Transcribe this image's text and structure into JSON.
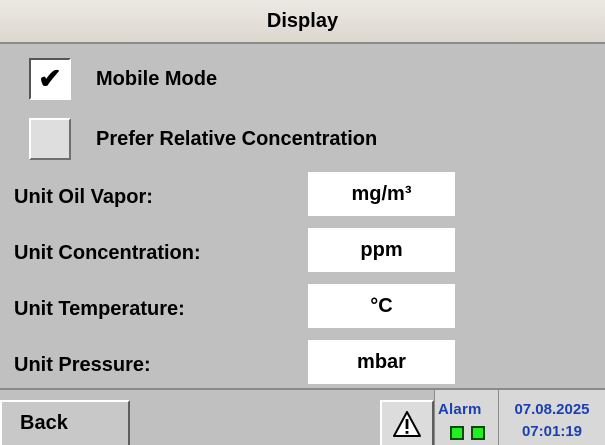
{
  "window": {
    "title": "Display"
  },
  "options": [
    {
      "label": "Mobile Mode",
      "checked": true
    },
    {
      "label": "Prefer Relative Concentration",
      "checked": false
    }
  ],
  "check_glyph": "✔",
  "units": [
    {
      "label": "Unit Oil Vapor:",
      "value": "mg/m³"
    },
    {
      "label": "Unit Concentration:",
      "value": "ppm"
    },
    {
      "label": "Unit Temperature:",
      "value": "°C"
    },
    {
      "label": "Unit Pressure:",
      "value": "mbar"
    }
  ],
  "footer": {
    "back_label": "Back",
    "alarm_icon": "warning-triangle",
    "alarm_label": "Alarm",
    "led_color": "#22ee22",
    "date": "07.08.2025",
    "time": "07:01:19"
  },
  "colors": {
    "background": "#c0c0c0",
    "status_text": "#1a3fb0",
    "field_bg": "#ffffff"
  }
}
